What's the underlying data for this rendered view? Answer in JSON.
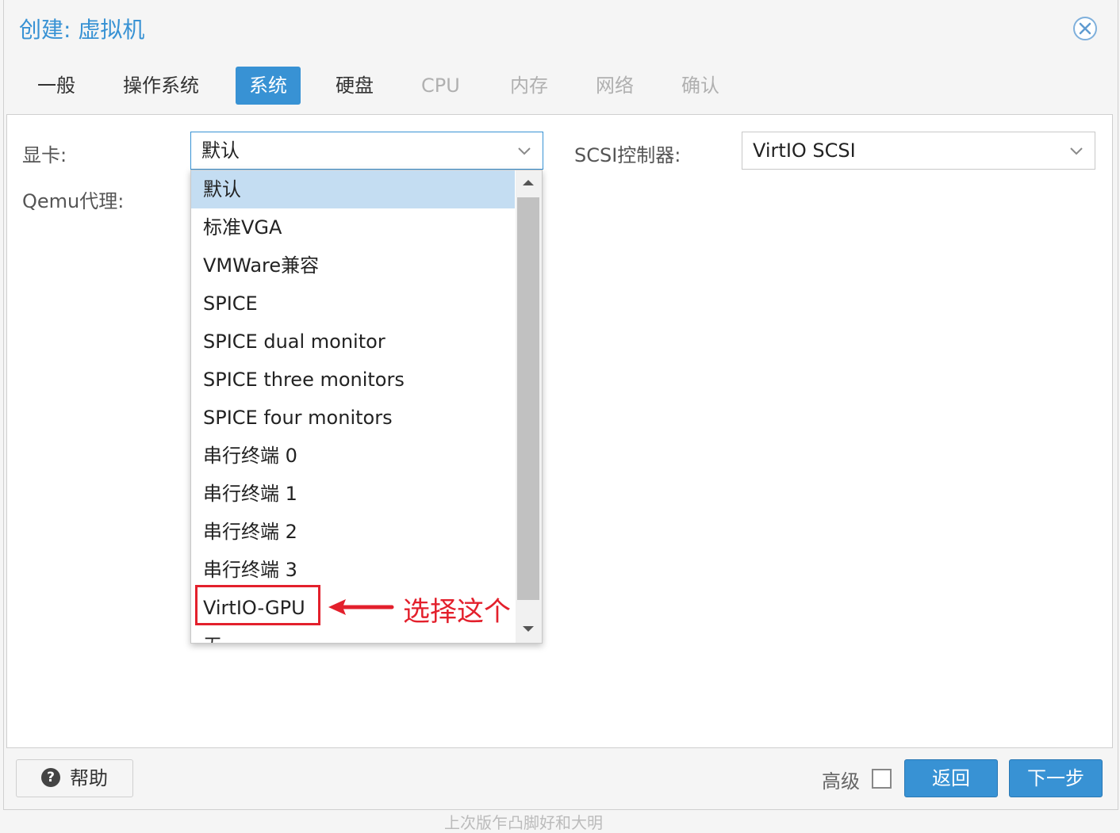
{
  "dialog": {
    "title": "创建: 虚拟机",
    "tabs": [
      {
        "label": "一般",
        "state": "normal"
      },
      {
        "label": "操作系统",
        "state": "normal"
      },
      {
        "label": "系统",
        "state": "active"
      },
      {
        "label": "硬盘",
        "state": "normal"
      },
      {
        "label": "CPU",
        "state": "disabled"
      },
      {
        "label": "内存",
        "state": "disabled"
      },
      {
        "label": "网络",
        "state": "disabled"
      },
      {
        "label": "确认",
        "state": "disabled"
      }
    ]
  },
  "form": {
    "display_label": "显卡:",
    "display_value": "默认",
    "qemu_agent_label": "Qemu代理:",
    "scsi_label": "SCSI控制器:",
    "scsi_value": "VirtIO SCSI"
  },
  "dropdown": {
    "selected_index": 0,
    "options": [
      "默认",
      "标准VGA",
      "VMWare兼容",
      "SPICE",
      "SPICE dual monitor",
      "SPICE three monitors",
      "SPICE four monitors",
      "串行终端 0",
      "串行终端 1",
      "串行终端 2",
      "串行终端 3",
      "VirtIO-GPU",
      "无"
    ]
  },
  "annotation": {
    "text": "选择这个",
    "color": "#e3202c",
    "target_option": "VirtIO-GPU"
  },
  "footer": {
    "help_label": "帮助",
    "advanced_label": "高级",
    "advanced_checked": false,
    "back_label": "返回",
    "next_label": "下一步"
  },
  "background_text": "上次版乍凸脚好和大明",
  "colors": {
    "accent": "#3892d4",
    "selected_row": "#c4ddf2",
    "annotation": "#e3202c"
  }
}
